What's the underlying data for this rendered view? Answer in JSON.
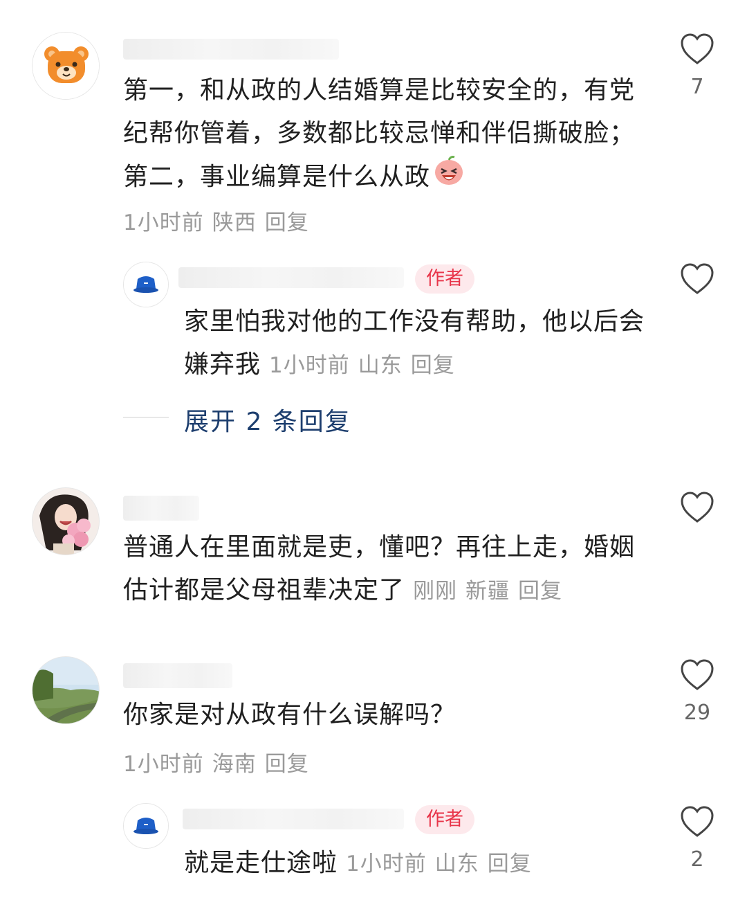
{
  "comments": [
    {
      "text": "第一，和从政的人结婚算是比较安全的，有党纪帮你管着，多数都比较忌惮和伴侣撕破脸；第二，事业编算是什么从政",
      "emoji": "laughing-face-emoji",
      "time": "1小时前",
      "location": "陕西",
      "reply": "回复",
      "likes": "7",
      "avatar": "bear-avatar",
      "reply_item": {
        "badge": "作者",
        "text": "家里怕我对他的工作没有帮助，他以后会嫌弃我",
        "time": "1小时前",
        "location": "山东",
        "reply": "回复",
        "avatar": "bucket-hat-avatar"
      },
      "expand": "展开 2 条回复"
    },
    {
      "text": "普通人在里面就是吏，懂吧？再往上走，婚姻估计都是父母祖辈决定了",
      "time": "刚刚",
      "location": "新疆",
      "reply": "回复",
      "avatar": "girl-with-flowers-avatar"
    },
    {
      "text": "你家是对从政有什么误解吗？",
      "time": "1小时前",
      "location": "海南",
      "reply": "回复",
      "likes": "29",
      "avatar": "road-landscape-avatar",
      "reply_item": {
        "badge": "作者",
        "text": "就是走仕途啦",
        "time": "1小时前",
        "location": "山东",
        "reply": "回复",
        "likes": "2",
        "avatar": "bucket-hat-avatar"
      }
    }
  ],
  "colors": {
    "author_badge_bg": "#fde9ec",
    "author_badge_text": "#e8354a",
    "expand_text": "#1d3e6e",
    "meta_text": "#9a9a9a"
  }
}
